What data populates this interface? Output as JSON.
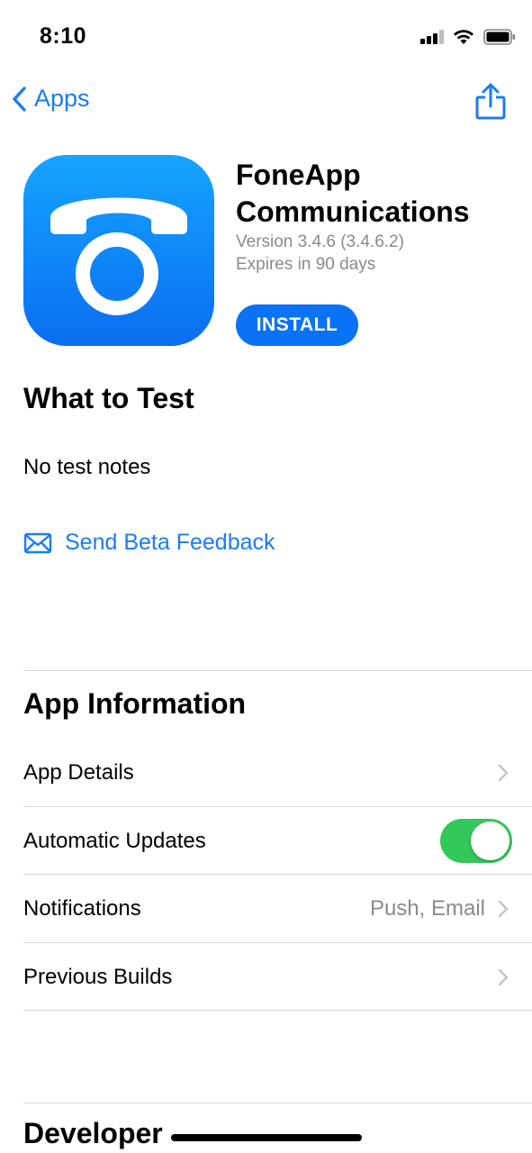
{
  "status_bar": {
    "time": "8:10"
  },
  "nav": {
    "back_label": "Apps"
  },
  "app": {
    "name": "FoneApp Communications",
    "version": "Version 3.4.6 (3.4.6.2)",
    "expires": "Expires in 90 days",
    "install_label": "INSTALL",
    "icon_color": "#0a7bf5"
  },
  "what_to_test": {
    "heading": "What to Test",
    "notes": "No test notes",
    "feedback_label": "Send Beta Feedback"
  },
  "app_information": {
    "heading": "App Information",
    "rows": [
      {
        "label": "App Details"
      },
      {
        "label": "Automatic Updates",
        "toggle": true
      },
      {
        "label": "Notifications",
        "value": "Push, Email"
      },
      {
        "label": "Previous Builds"
      }
    ]
  },
  "developer": {
    "heading": "Developer"
  },
  "colors": {
    "accent": "#1a7cf5",
    "toggle_on": "#34c759",
    "secondary_text": "#8a8a8e"
  }
}
